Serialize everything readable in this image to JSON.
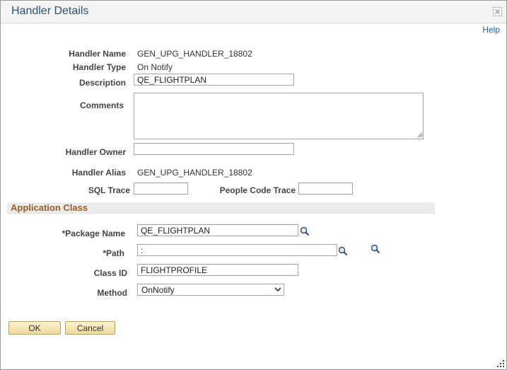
{
  "dialog": {
    "title": "Handler Details",
    "help_label": "Help"
  },
  "handler": {
    "name_label": "Handler Name",
    "name_value": "GEN_UPG_HANDLER_18802",
    "type_label": "Handler Type",
    "type_value": "On Notify",
    "description_label": "Description",
    "description_value": "QE_FLIGHTPLAN",
    "comments_label": "Comments",
    "comments_value": "",
    "owner_label": "Handler Owner",
    "owner_value": "",
    "alias_label": "Handler Alias",
    "alias_value": "GEN_UPG_HANDLER_18802",
    "sql_trace_label": "SQL Trace",
    "sql_trace_value": "",
    "peoplecode_trace_label": "People Code Trace",
    "peoplecode_trace_value": ""
  },
  "app_class": {
    "section_title": "Application Class",
    "package_label": "*Package Name",
    "package_value": "QE_FLIGHTPLAN",
    "path_label": "*Path",
    "path_value": ":",
    "class_label": "Class ID",
    "class_value": "FLIGHTPROFILE",
    "method_label": "Method",
    "method_value": "OnNotify"
  },
  "buttons": {
    "ok_label": "OK",
    "cancel_label": "Cancel"
  },
  "icons": {
    "close": "close-icon",
    "lookup": "magnifier-icon",
    "dropdown": "chevron-down-icon",
    "resize": "resize-grip-icon"
  }
}
